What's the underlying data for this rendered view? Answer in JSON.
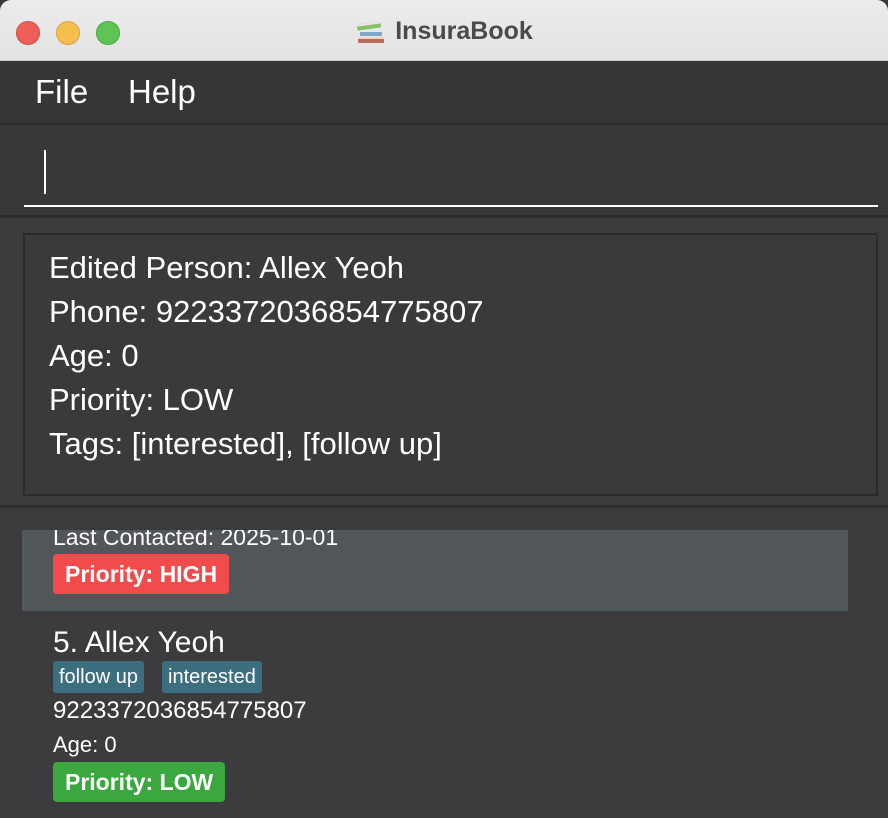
{
  "window": {
    "title": "InsuraBook"
  },
  "menu": {
    "file": "File",
    "help": "Help"
  },
  "command": {
    "value": ""
  },
  "result": {
    "lines": [
      "Edited Person: Allex Yeoh",
      "Phone: 9223372036854775807",
      "Age: 0",
      "Priority: LOW",
      "Tags: [interested], [follow up]"
    ]
  },
  "list": {
    "cards": [
      {
        "last_contacted": "Last Contacted: 2025-10-01",
        "priority": "Priority: HIGH"
      },
      {
        "name": "5. Allex Yeoh",
        "tags": [
          "follow up",
          "interested"
        ],
        "phone": "9223372036854775807",
        "age": "Age: 0",
        "priority": "Priority: LOW"
      }
    ]
  },
  "colors": {
    "priority_high": "#f24b4b",
    "priority_low": "#3aa83e",
    "tag": "#3c6e80"
  },
  "icons": [
    "app-books-icon"
  ]
}
